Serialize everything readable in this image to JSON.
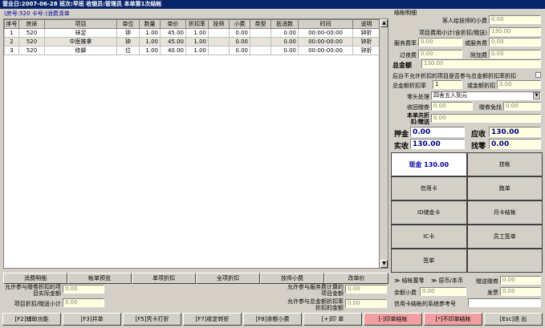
{
  "titlebar": "营业日:2007-06-28 班次:早班 收银员:管理员 本单第1次结帐",
  "bill_title": "(房号:520 卡号:)消费清单",
  "table": {
    "headers": [
      "序号",
      "房床",
      "项目",
      "单位",
      "数量",
      "单价",
      "折扣率",
      "技师",
      "小费",
      "类型",
      "抵消数",
      "时间",
      "说明"
    ],
    "rows": [
      [
        "1",
        "520",
        "袜足",
        "钟",
        "1.00",
        "45.00",
        "1.00",
        "",
        "0.00",
        "",
        "0.00",
        "00:00-00:00",
        "钟折"
      ],
      [
        "2",
        "520",
        "中医推拿",
        "钟",
        "1.00",
        "45.00",
        "1.00",
        "",
        "0.00",
        "",
        "0.00",
        "00:00-00:00",
        "钟折"
      ],
      [
        "3",
        "520",
        "修脚",
        "位",
        "1.00",
        "40.00",
        "1.00",
        "",
        "0.00",
        "",
        "0.00",
        "00:00-00:00",
        "钟折"
      ]
    ]
  },
  "action_buttons": [
    "消费明细",
    "帐单预览",
    "单项折扣",
    "全项折扣",
    "技师小费",
    "改单价"
  ],
  "lower": {
    "l1": "允许参与赠卷折扣的项目实际金额",
    "v1": "0.00",
    "l2": "项目折扣/赠送小计",
    "v2": "0.00",
    "l3": "允许参与服务费计算的项目金额",
    "v3": "0.00",
    "l4": "允许参与总金额折扣率折扣的金额",
    "v4": "0.00"
  },
  "panel": {
    "title": "结帐明细",
    "tip_label": "客人给技师的小费",
    "tip": "0.00",
    "subtotal_label": "项目费用小计(含折扣/赠送)",
    "subtotal": "130.00",
    "service_fee_label": "服务费率",
    "service_fee": "0.00",
    "service_charge_label": "或服务费",
    "service_charge": "0.00",
    "overnight_label": "过夜费",
    "overnight": "0.00",
    "extra_label": "附加费",
    "extra": "0.00",
    "total_label": "总金额",
    "total": "130.00",
    "disc_note": "后台不允许折扣的项目是否参与总金额折扣率折扣",
    "total_disc_label": "总金额折扣率",
    "total_disc": "1",
    "or_total_disc_label": "或金额折扣",
    "or_total_disc": "0.00",
    "rounding_label": "零头处理",
    "rounding": "四舍五入到元",
    "coupon_label": "收回赠券",
    "coupon": "0.00",
    "coupon_free_label": "赠券免找",
    "coupon_free": "0.00",
    "bill_total_label": "本单共折扣/赠送",
    "bill_total": "0.00",
    "deposit_label": "押金",
    "deposit": "0.00",
    "receivable_label": "应收",
    "receivable": "130.00",
    "received_label": "实收",
    "received": "130.00",
    "change_label": "找零",
    "change": "0.00"
  },
  "pay": [
    "现金 130.00",
    "挂帐",
    "信用卡",
    "跑单",
    "ID储金卡",
    "月卡结帐",
    "IC卡",
    "员工签单",
    "签单",
    ""
  ],
  "payfoot": {
    "zero_label": "≫ 结帐置零",
    "currency_label": "≫ 原币/本币",
    "gift_label": "赠送赠券",
    "gift": "0.00",
    "bal_label": "余额小费",
    "bal": "0.00",
    "invoice_label": "发票",
    "invoice": "0.00",
    "cc_label": "信用卡结帐的系统参考号"
  },
  "bottom": [
    "[F2]辅助功能",
    "[F3]并单",
    "[F5]凭卡打折",
    "[F7]收定转折",
    "[F8]余额小费",
    "[+]印 单",
    "[-]印单结帐",
    "[*]不印单结帐",
    "[Esc]退 出"
  ],
  "colors": {
    "titlebar": "#0a246a",
    "field": "#ffffe0",
    "active_pay": "#ffffff",
    "danger": "#f0a0a0"
  }
}
